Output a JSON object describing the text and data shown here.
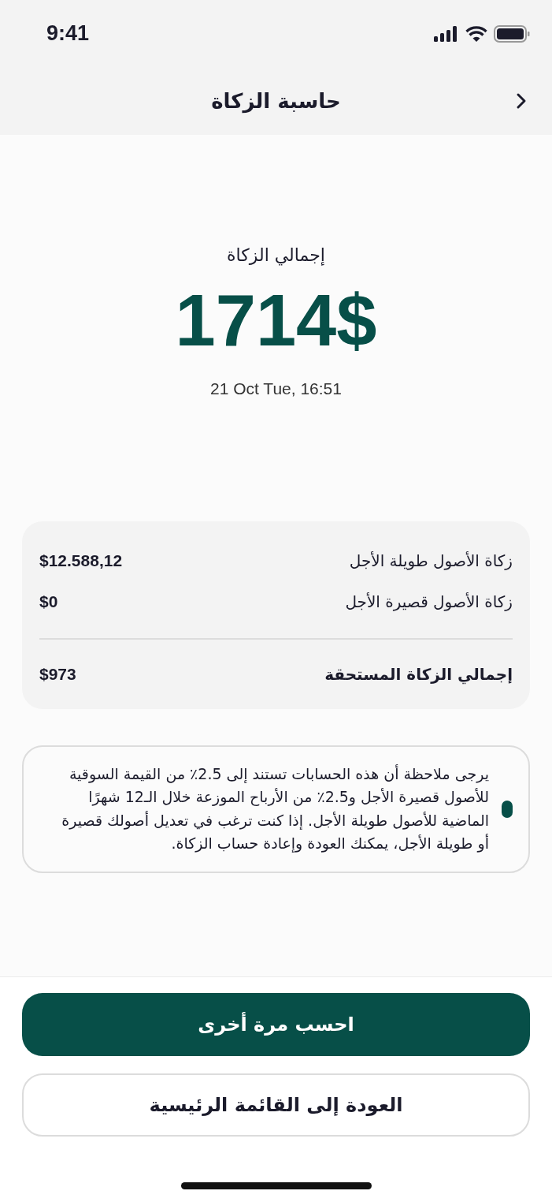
{
  "status_bar": {
    "time": "9:41"
  },
  "nav": {
    "title": "حاسبة الزكاة"
  },
  "total": {
    "label": "إجمالي الزكاة",
    "amount": "1714$",
    "date": "21 Oct Tue, 16:51"
  },
  "summary": {
    "rows": [
      {
        "kind": "item",
        "label": "زكاة الأصول طويلة الأجل",
        "value": "$12.588,12"
      },
      {
        "kind": "item",
        "label": "زكاة الأصول قصيرة الأجل",
        "value": "$0"
      },
      {
        "kind": "total",
        "label": "إجمالي الزكاة المستحقة",
        "value": "$973"
      }
    ]
  },
  "note": {
    "text": "يرجى ملاحظة أن هذه الحسابات تستند إلى 2.5٪ من القيمة السوقية للأصول قصيرة الأجل و2.5٪ من الأرباح الموزعة خلال الـ12 شهرًا الماضية للأصول طويلة الأجل. إذا كنت ترغب في تعديل أصولك قصيرة أو طويلة الأجل، يمكنك العودة وإعادة حساب الزكاة."
  },
  "buttons": [
    {
      "kind": "primary",
      "label": "احسب مرة أخرى"
    },
    {
      "kind": "secondary",
      "label": "العودة إلى القائمة الرئيسية"
    }
  ]
}
